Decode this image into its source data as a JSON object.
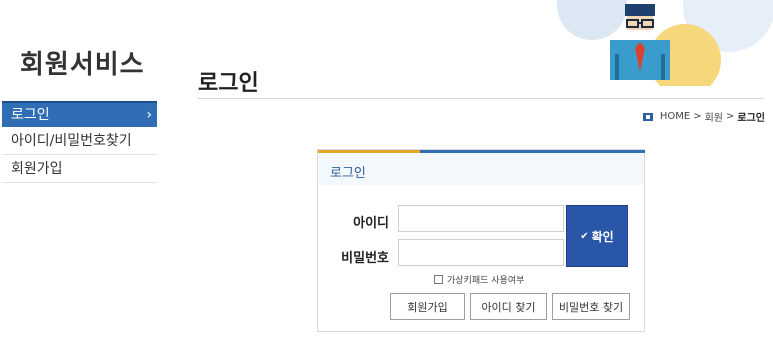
{
  "sidebar": {
    "title": "회원서비스",
    "items": [
      {
        "label": "로그인",
        "active": true
      },
      {
        "label": "아이디/비밀번호찾기",
        "active": false
      },
      {
        "label": "회원가입",
        "active": false
      }
    ],
    "active_chevron": "›"
  },
  "header": {
    "title": "로그인"
  },
  "breadcrumb": {
    "home": "HOME",
    "separator": ">",
    "section": "회원",
    "current": "로그인"
  },
  "login": {
    "box_title": "로그인",
    "id_label": "아이디",
    "pw_label": "비밀번호",
    "id_value": "",
    "pw_value": "",
    "submit_label": "확인",
    "virtual_keypad_label": "가상키패드 사용여부",
    "virtual_keypad_checked": false,
    "buttons": {
      "signup": "회원가입",
      "find_id": "아이디 찾기",
      "find_pw": "비밀번호 찾기"
    }
  },
  "colors": {
    "accent_blue": "#2f6db5",
    "button_blue": "#2a56a8",
    "accent_orange": "#e3a628",
    "deco_yellow": "#f6d77b",
    "deco_blue_light": "#cfe3f4"
  },
  "icons": {
    "home": "home-icon",
    "check": "check-icon",
    "chevron": "chevron-right-icon"
  }
}
